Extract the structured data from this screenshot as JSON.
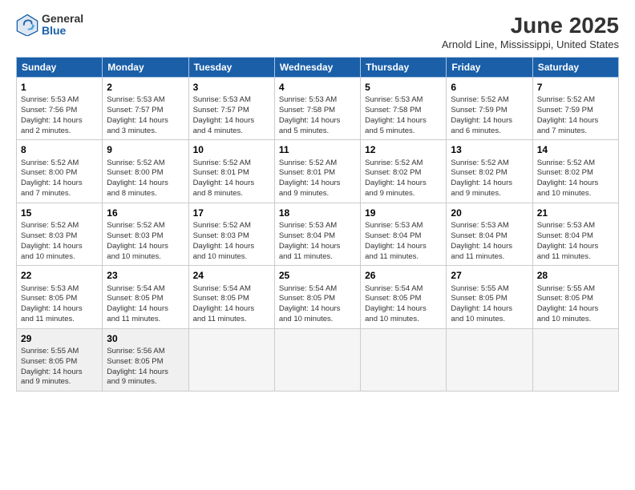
{
  "header": {
    "logo_general": "General",
    "logo_blue": "Blue",
    "month_title": "June 2025",
    "location": "Arnold Line, Mississippi, United States"
  },
  "days_of_week": [
    "Sunday",
    "Monday",
    "Tuesday",
    "Wednesday",
    "Thursday",
    "Friday",
    "Saturday"
  ],
  "weeks": [
    [
      {
        "day": "1",
        "lines": [
          "Sunrise: 5:53 AM",
          "Sunset: 7:56 PM",
          "Daylight: 14 hours",
          "and 2 minutes."
        ]
      },
      {
        "day": "2",
        "lines": [
          "Sunrise: 5:53 AM",
          "Sunset: 7:57 PM",
          "Daylight: 14 hours",
          "and 3 minutes."
        ]
      },
      {
        "day": "3",
        "lines": [
          "Sunrise: 5:53 AM",
          "Sunset: 7:57 PM",
          "Daylight: 14 hours",
          "and 4 minutes."
        ]
      },
      {
        "day": "4",
        "lines": [
          "Sunrise: 5:53 AM",
          "Sunset: 7:58 PM",
          "Daylight: 14 hours",
          "and 5 minutes."
        ]
      },
      {
        "day": "5",
        "lines": [
          "Sunrise: 5:53 AM",
          "Sunset: 7:58 PM",
          "Daylight: 14 hours",
          "and 5 minutes."
        ]
      },
      {
        "day": "6",
        "lines": [
          "Sunrise: 5:52 AM",
          "Sunset: 7:59 PM",
          "Daylight: 14 hours",
          "and 6 minutes."
        ]
      },
      {
        "day": "7",
        "lines": [
          "Sunrise: 5:52 AM",
          "Sunset: 7:59 PM",
          "Daylight: 14 hours",
          "and 7 minutes."
        ]
      }
    ],
    [
      {
        "day": "8",
        "lines": [
          "Sunrise: 5:52 AM",
          "Sunset: 8:00 PM",
          "Daylight: 14 hours",
          "and 7 minutes."
        ]
      },
      {
        "day": "9",
        "lines": [
          "Sunrise: 5:52 AM",
          "Sunset: 8:00 PM",
          "Daylight: 14 hours",
          "and 8 minutes."
        ]
      },
      {
        "day": "10",
        "lines": [
          "Sunrise: 5:52 AM",
          "Sunset: 8:01 PM",
          "Daylight: 14 hours",
          "and 8 minutes."
        ]
      },
      {
        "day": "11",
        "lines": [
          "Sunrise: 5:52 AM",
          "Sunset: 8:01 PM",
          "Daylight: 14 hours",
          "and 9 minutes."
        ]
      },
      {
        "day": "12",
        "lines": [
          "Sunrise: 5:52 AM",
          "Sunset: 8:02 PM",
          "Daylight: 14 hours",
          "and 9 minutes."
        ]
      },
      {
        "day": "13",
        "lines": [
          "Sunrise: 5:52 AM",
          "Sunset: 8:02 PM",
          "Daylight: 14 hours",
          "and 9 minutes."
        ]
      },
      {
        "day": "14",
        "lines": [
          "Sunrise: 5:52 AM",
          "Sunset: 8:02 PM",
          "Daylight: 14 hours",
          "and 10 minutes."
        ]
      }
    ],
    [
      {
        "day": "15",
        "lines": [
          "Sunrise: 5:52 AM",
          "Sunset: 8:03 PM",
          "Daylight: 14 hours",
          "and 10 minutes."
        ]
      },
      {
        "day": "16",
        "lines": [
          "Sunrise: 5:52 AM",
          "Sunset: 8:03 PM",
          "Daylight: 14 hours",
          "and 10 minutes."
        ]
      },
      {
        "day": "17",
        "lines": [
          "Sunrise: 5:52 AM",
          "Sunset: 8:03 PM",
          "Daylight: 14 hours",
          "and 10 minutes."
        ]
      },
      {
        "day": "18",
        "lines": [
          "Sunrise: 5:53 AM",
          "Sunset: 8:04 PM",
          "Daylight: 14 hours",
          "and 11 minutes."
        ]
      },
      {
        "day": "19",
        "lines": [
          "Sunrise: 5:53 AM",
          "Sunset: 8:04 PM",
          "Daylight: 14 hours",
          "and 11 minutes."
        ]
      },
      {
        "day": "20",
        "lines": [
          "Sunrise: 5:53 AM",
          "Sunset: 8:04 PM",
          "Daylight: 14 hours",
          "and 11 minutes."
        ]
      },
      {
        "day": "21",
        "lines": [
          "Sunrise: 5:53 AM",
          "Sunset: 8:04 PM",
          "Daylight: 14 hours",
          "and 11 minutes."
        ]
      }
    ],
    [
      {
        "day": "22",
        "lines": [
          "Sunrise: 5:53 AM",
          "Sunset: 8:05 PM",
          "Daylight: 14 hours",
          "and 11 minutes."
        ]
      },
      {
        "day": "23",
        "lines": [
          "Sunrise: 5:54 AM",
          "Sunset: 8:05 PM",
          "Daylight: 14 hours",
          "and 11 minutes."
        ]
      },
      {
        "day": "24",
        "lines": [
          "Sunrise: 5:54 AM",
          "Sunset: 8:05 PM",
          "Daylight: 14 hours",
          "and 11 minutes."
        ]
      },
      {
        "day": "25",
        "lines": [
          "Sunrise: 5:54 AM",
          "Sunset: 8:05 PM",
          "Daylight: 14 hours",
          "and 10 minutes."
        ]
      },
      {
        "day": "26",
        "lines": [
          "Sunrise: 5:54 AM",
          "Sunset: 8:05 PM",
          "Daylight: 14 hours",
          "and 10 minutes."
        ]
      },
      {
        "day": "27",
        "lines": [
          "Sunrise: 5:55 AM",
          "Sunset: 8:05 PM",
          "Daylight: 14 hours",
          "and 10 minutes."
        ]
      },
      {
        "day": "28",
        "lines": [
          "Sunrise: 5:55 AM",
          "Sunset: 8:05 PM",
          "Daylight: 14 hours",
          "and 10 minutes."
        ]
      }
    ],
    [
      {
        "day": "29",
        "lines": [
          "Sunrise: 5:55 AM",
          "Sunset: 8:05 PM",
          "Daylight: 14 hours",
          "and 9 minutes."
        ]
      },
      {
        "day": "30",
        "lines": [
          "Sunrise: 5:56 AM",
          "Sunset: 8:05 PM",
          "Daylight: 14 hours",
          "and 9 minutes."
        ]
      },
      {
        "day": "",
        "lines": []
      },
      {
        "day": "",
        "lines": []
      },
      {
        "day": "",
        "lines": []
      },
      {
        "day": "",
        "lines": []
      },
      {
        "day": "",
        "lines": []
      }
    ]
  ]
}
